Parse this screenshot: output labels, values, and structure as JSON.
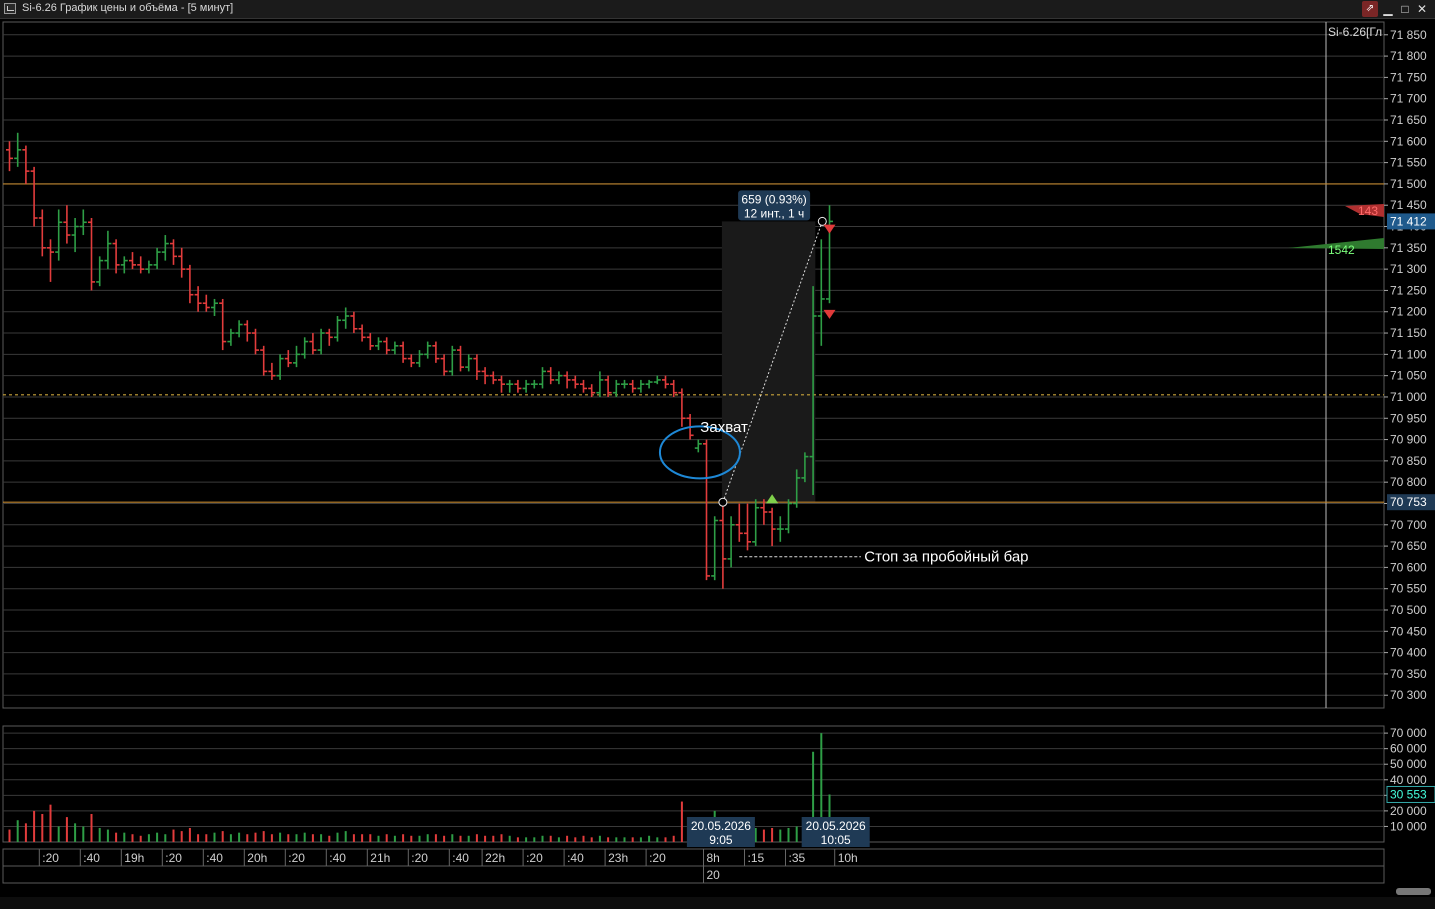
{
  "window": {
    "title": "Si-6.26 График цены и объёма - [5 минут]",
    "buttons": {
      "pin": "⇗",
      "minimize": "▁",
      "maximize": "□",
      "close": "✕"
    },
    "icons": {
      "app": "chart-window-icon",
      "pin": "pin-icon"
    }
  },
  "chart_data": {
    "type": "candlestick",
    "instrument_label": "Si-6.26[Гл",
    "price_axis": {
      "range": [
        70270,
        71880
      ],
      "ticks": [
        71850,
        71800,
        71750,
        71700,
        71650,
        71600,
        71550,
        71500,
        71450,
        71400,
        71350,
        71300,
        71250,
        71200,
        71150,
        71100,
        71050,
        71000,
        70950,
        70900,
        70850,
        70800,
        70750,
        70700,
        70650,
        70600,
        70550,
        70500,
        70450,
        70400,
        70350,
        70300
      ],
      "tick_labels": [
        "71 850",
        "71 800",
        "71 750",
        "71 700",
        "71 650",
        "71 600",
        "71 550",
        "71 500",
        "71 450",
        "71 400",
        "71 350",
        "71 300",
        "71 250",
        "71 200",
        "71 150",
        "71 100",
        "71 050",
        "71 000",
        "70 950",
        "70 900",
        "70 850",
        "70 800",
        "70 750",
        "70 700",
        "70 650",
        "70 600",
        "70 550",
        "70 500",
        "70 450",
        "70 400",
        "70 350",
        "70 300"
      ]
    },
    "current_price": {
      "value": 71412,
      "label": "71 412",
      "color": "#1f5a8c"
    },
    "reference_price": {
      "value": 70753,
      "label": "70 753"
    },
    "horizontal_lines": [
      {
        "price": 71500,
        "style": "solid",
        "color": "#c0862e"
      },
      {
        "price": 71005,
        "style": "dashed",
        "color": "#c9a43a"
      },
      {
        "price": 70753,
        "style": "solid",
        "color": "#c0862e"
      }
    ],
    "measure": {
      "label_line1": "659 (0.93%)",
      "label_line2": "12 инт., 1 ч",
      "from": {
        "bar": 87,
        "price": 70753
      },
      "to": {
        "bar": 99,
        "price": 71412
      }
    },
    "annotations": [
      {
        "text": "Захват",
        "bar": 84,
        "price": 70930
      },
      {
        "text": "Стоп за пробойный бар",
        "bar": 104,
        "price": 70625
      }
    ],
    "stop_line": {
      "from_bar": 89,
      "to_bar": 102,
      "price": 70625
    },
    "ellipse": {
      "bar": 84.2,
      "price": 70870
    },
    "signals": [
      {
        "type": "buy",
        "bar": 93,
        "price": 70760,
        "color": "#7fd04a"
      },
      {
        "type": "sell",
        "bar": 100,
        "price": 71395,
        "color": "#e03a3a"
      },
      {
        "type": "sell",
        "bar": 100,
        "price": 71195,
        "color": "#e03a3a"
      }
    ],
    "profile": {
      "sell_label": "143",
      "buy_label": "1542",
      "sell_color": "#b03030",
      "buy_color": "#2f7a2f"
    },
    "volume_axis": {
      "range": [
        0,
        72000
      ],
      "ticks": [
        70000,
        60000,
        50000,
        40000,
        30000,
        20000,
        10000
      ],
      "tick_labels": [
        "70 000",
        "60 000",
        "50 000",
        "40 000",
        "30 000",
        "20 000",
        "10 000"
      ],
      "current_label": "30 553",
      "current_value": 30553
    },
    "time_axis": {
      "labels": [
        {
          "text": ":20",
          "bar": 4
        },
        {
          "text": ":40",
          "bar": 9
        },
        {
          "text": "19h",
          "bar": 14
        },
        {
          "text": ":20",
          "bar": 19
        },
        {
          "text": ":40",
          "bar": 24
        },
        {
          "text": "20h",
          "bar": 29
        },
        {
          "text": ":20",
          "bar": 34
        },
        {
          "text": ":40",
          "bar": 39
        },
        {
          "text": "21h",
          "bar": 44
        },
        {
          "text": ":20",
          "bar": 49
        },
        {
          "text": ":40",
          "bar": 54
        },
        {
          "text": "22h",
          "bar": 58
        },
        {
          "text": ":20",
          "bar": 63
        },
        {
          "text": ":40",
          "bar": 68
        },
        {
          "text": "23h",
          "bar": 73
        },
        {
          "text": ":20",
          "bar": 78
        },
        {
          "text": "8h",
          "bar": 85
        },
        {
          "text": ":15",
          "bar": 90
        },
        {
          "text": ":35",
          "bar": 95
        },
        {
          "text": "10h",
          "bar": 101
        }
      ],
      "day_label": {
        "text": "20",
        "bar": 85
      },
      "cursor_labels": [
        {
          "bar": 87,
          "line1": "20.05.2026",
          "line2": "9:05"
        },
        {
          "bar": 101,
          "line1": "20.05.2026",
          "line2": "10:05"
        }
      ]
    },
    "colors": {
      "up": "#2e9e46",
      "down": "#e23c3c",
      "grid": "#3a3a3a",
      "axis_text": "#cfcfcf",
      "measure_box": "#1f3a55"
    },
    "bars": [
      {
        "o": 71580,
        "h": 71600,
        "l": 71530,
        "c": 71560,
        "v": 8000
      },
      {
        "o": 71560,
        "h": 71620,
        "l": 71540,
        "c": 71580,
        "v": 14000
      },
      {
        "o": 71580,
        "h": 71590,
        "l": 71500,
        "c": 71530,
        "v": 12000
      },
      {
        "o": 71530,
        "h": 71540,
        "l": 71400,
        "c": 71420,
        "v": 20000
      },
      {
        "o": 71420,
        "h": 71440,
        "l": 71330,
        "c": 71350,
        "v": 18000
      },
      {
        "o": 71350,
        "h": 71370,
        "l": 71270,
        "c": 71340,
        "v": 24000
      },
      {
        "o": 71340,
        "h": 71440,
        "l": 71320,
        "c": 71410,
        "v": 10000
      },
      {
        "o": 71410,
        "h": 71450,
        "l": 71360,
        "c": 71380,
        "v": 16000
      },
      {
        "o": 71380,
        "h": 71420,
        "l": 71340,
        "c": 71400,
        "v": 12000
      },
      {
        "o": 71400,
        "h": 71440,
        "l": 71380,
        "c": 71410,
        "v": 10000
      },
      {
        "o": 71410,
        "h": 71420,
        "l": 71250,
        "c": 71270,
        "v": 18000
      },
      {
        "o": 71270,
        "h": 71330,
        "l": 71260,
        "c": 71320,
        "v": 9000
      },
      {
        "o": 71320,
        "h": 71390,
        "l": 71300,
        "c": 71360,
        "v": 8000
      },
      {
        "o": 71360,
        "h": 71370,
        "l": 71290,
        "c": 71310,
        "v": 6000
      },
      {
        "o": 71310,
        "h": 71330,
        "l": 71290,
        "c": 71320,
        "v": 6000
      },
      {
        "o": 71320,
        "h": 71340,
        "l": 71300,
        "c": 71310,
        "v": 5000
      },
      {
        "o": 71310,
        "h": 71330,
        "l": 71290,
        "c": 71300,
        "v": 4000
      },
      {
        "o": 71300,
        "h": 71320,
        "l": 71290,
        "c": 71310,
        "v": 5000
      },
      {
        "o": 71310,
        "h": 71350,
        "l": 71300,
        "c": 71340,
        "v": 6000
      },
      {
        "o": 71340,
        "h": 71380,
        "l": 71320,
        "c": 71360,
        "v": 5000
      },
      {
        "o": 71360,
        "h": 71370,
        "l": 71310,
        "c": 71330,
        "v": 8000
      },
      {
        "o": 71330,
        "h": 71350,
        "l": 71280,
        "c": 71300,
        "v": 7000
      },
      {
        "o": 71300,
        "h": 71310,
        "l": 71220,
        "c": 71240,
        "v": 9000
      },
      {
        "o": 71240,
        "h": 71260,
        "l": 71200,
        "c": 71220,
        "v": 5000
      },
      {
        "o": 71220,
        "h": 71240,
        "l": 71200,
        "c": 71210,
        "v": 5000
      },
      {
        "o": 71210,
        "h": 71230,
        "l": 71190,
        "c": 71220,
        "v": 6000
      },
      {
        "o": 71220,
        "h": 71230,
        "l": 71110,
        "c": 71130,
        "v": 7000
      },
      {
        "o": 71130,
        "h": 71160,
        "l": 71120,
        "c": 71150,
        "v": 5000
      },
      {
        "o": 71150,
        "h": 71180,
        "l": 71140,
        "c": 71170,
        "v": 6000
      },
      {
        "o": 71170,
        "h": 71180,
        "l": 71130,
        "c": 71150,
        "v": 5000
      },
      {
        "o": 71150,
        "h": 71160,
        "l": 71100,
        "c": 71110,
        "v": 6000
      },
      {
        "o": 71110,
        "h": 71120,
        "l": 71050,
        "c": 71060,
        "v": 7000
      },
      {
        "o": 71060,
        "h": 71080,
        "l": 71040,
        "c": 71050,
        "v": 5000
      },
      {
        "o": 71050,
        "h": 71100,
        "l": 71040,
        "c": 71090,
        "v": 6000
      },
      {
        "o": 71090,
        "h": 71110,
        "l": 71070,
        "c": 71080,
        "v": 5000
      },
      {
        "o": 71080,
        "h": 71120,
        "l": 71070,
        "c": 71100,
        "v": 5000
      },
      {
        "o": 71100,
        "h": 71140,
        "l": 71090,
        "c": 71130,
        "v": 6000
      },
      {
        "o": 71130,
        "h": 71150,
        "l": 71100,
        "c": 71110,
        "v": 5000
      },
      {
        "o": 71110,
        "h": 71160,
        "l": 71100,
        "c": 71150,
        "v": 5000
      },
      {
        "o": 71150,
        "h": 71160,
        "l": 71120,
        "c": 71140,
        "v": 4000
      },
      {
        "o": 71140,
        "h": 71190,
        "l": 71130,
        "c": 71180,
        "v": 6000
      },
      {
        "o": 71180,
        "h": 71210,
        "l": 71160,
        "c": 71190,
        "v": 7000
      },
      {
        "o": 71190,
        "h": 71200,
        "l": 71150,
        "c": 71160,
        "v": 5000
      },
      {
        "o": 71160,
        "h": 71170,
        "l": 71130,
        "c": 71140,
        "v": 5000
      },
      {
        "o": 71140,
        "h": 71150,
        "l": 71110,
        "c": 71120,
        "v": 5000
      },
      {
        "o": 71120,
        "h": 71140,
        "l": 71110,
        "c": 71130,
        "v": 4000
      },
      {
        "o": 71130,
        "h": 71140,
        "l": 71100,
        "c": 71110,
        "v": 5000
      },
      {
        "o": 71110,
        "h": 71130,
        "l": 71100,
        "c": 71120,
        "v": 4000
      },
      {
        "o": 71120,
        "h": 71130,
        "l": 71080,
        "c": 71090,
        "v": 5000
      },
      {
        "o": 71090,
        "h": 71100,
        "l": 71070,
        "c": 71080,
        "v": 4000
      },
      {
        "o": 71080,
        "h": 71110,
        "l": 71070,
        "c": 71100,
        "v": 4000
      },
      {
        "o": 71100,
        "h": 71130,
        "l": 71090,
        "c": 71120,
        "v": 5000
      },
      {
        "o": 71120,
        "h": 71130,
        "l": 71080,
        "c": 71090,
        "v": 5000
      },
      {
        "o": 71090,
        "h": 71100,
        "l": 71050,
        "c": 71060,
        "v": 4000
      },
      {
        "o": 71060,
        "h": 71120,
        "l": 71050,
        "c": 71110,
        "v": 5000
      },
      {
        "o": 71110,
        "h": 71120,
        "l": 71060,
        "c": 71070,
        "v": 4000
      },
      {
        "o": 71070,
        "h": 71100,
        "l": 71060,
        "c": 71090,
        "v": 4000
      },
      {
        "o": 71090,
        "h": 71100,
        "l": 71040,
        "c": 71060,
        "v": 5000
      },
      {
        "o": 71060,
        "h": 71070,
        "l": 71030,
        "c": 71050,
        "v": 4000
      },
      {
        "o": 71050,
        "h": 71060,
        "l": 71030,
        "c": 71040,
        "v": 4000
      },
      {
        "o": 71040,
        "h": 71050,
        "l": 71010,
        "c": 71030,
        "v": 5000
      },
      {
        "o": 71030,
        "h": 71040,
        "l": 71010,
        "c": 71030,
        "v": 4000
      },
      {
        "o": 71030,
        "h": 71040,
        "l": 71010,
        "c": 71020,
        "v": 3000
      },
      {
        "o": 71020,
        "h": 71040,
        "l": 71010,
        "c": 71030,
        "v": 3000
      },
      {
        "o": 71030,
        "h": 71040,
        "l": 71020,
        "c": 71030,
        "v": 3000
      },
      {
        "o": 71030,
        "h": 71070,
        "l": 71020,
        "c": 71060,
        "v": 4000
      },
      {
        "o": 71060,
        "h": 71070,
        "l": 71030,
        "c": 71040,
        "v": 4000
      },
      {
        "o": 71040,
        "h": 71060,
        "l": 71030,
        "c": 71050,
        "v": 3000
      },
      {
        "o": 71050,
        "h": 71060,
        "l": 71020,
        "c": 71040,
        "v": 4000
      },
      {
        "o": 71040,
        "h": 71050,
        "l": 71020,
        "c": 71030,
        "v": 3000
      },
      {
        "o": 71030,
        "h": 71040,
        "l": 71010,
        "c": 71020,
        "v": 4000
      },
      {
        "o": 71020,
        "h": 71030,
        "l": 71000,
        "c": 71010,
        "v": 3000
      },
      {
        "o": 71010,
        "h": 71060,
        "l": 71000,
        "c": 71040,
        "v": 4000
      },
      {
        "o": 71040,
        "h": 71050,
        "l": 71000,
        "c": 71010,
        "v": 3000
      },
      {
        "o": 71010,
        "h": 71040,
        "l": 71000,
        "c": 71030,
        "v": 3000
      },
      {
        "o": 71030,
        "h": 71040,
        "l": 71020,
        "c": 71030,
        "v": 3000
      },
      {
        "o": 71030,
        "h": 71040,
        "l": 71010,
        "c": 71020,
        "v": 3000
      },
      {
        "o": 71020,
        "h": 71040,
        "l": 71010,
        "c": 71030,
        "v": 3000
      },
      {
        "o": 71030,
        "h": 71040,
        "l": 71020,
        "c": 71035,
        "v": 4000
      },
      {
        "o": 71035,
        "h": 71050,
        "l": 71030,
        "c": 71040,
        "v": 3000
      },
      {
        "o": 71040,
        "h": 71050,
        "l": 71020,
        "c": 71030,
        "v": 3000
      },
      {
        "o": 71030,
        "h": 71040,
        "l": 71000,
        "c": 71010,
        "v": 4000
      },
      {
        "o": 71010,
        "h": 71020,
        "l": 70930,
        "c": 70950,
        "v": 26000
      },
      {
        "o": 70950,
        "h": 70960,
        "l": 70900,
        "c": 70910,
        "v": 12000
      },
      {
        "o": 70880,
        "h": 70900,
        "l": 70870,
        "c": 70890,
        "v": 6000
      },
      {
        "o": 70890,
        "h": 70900,
        "l": 70570,
        "c": 70580,
        "v": 14000
      },
      {
        "o": 70580,
        "h": 70720,
        "l": 70570,
        "c": 70710,
        "v": 20000
      },
      {
        "o": 70710,
        "h": 70750,
        "l": 70550,
        "c": 70620,
        "v": 9000
      },
      {
        "o": 70620,
        "h": 70720,
        "l": 70600,
        "c": 70700,
        "v": 10000
      },
      {
        "o": 70700,
        "h": 70750,
        "l": 70660,
        "c": 70680,
        "v": 8000
      },
      {
        "o": 70680,
        "h": 70750,
        "l": 70640,
        "c": 70660,
        "v": 7000
      },
      {
        "o": 70660,
        "h": 70760,
        "l": 70650,
        "c": 70740,
        "v": 9000
      },
      {
        "o": 70740,
        "h": 70760,
        "l": 70700,
        "c": 70730,
        "v": 8000
      },
      {
        "o": 70730,
        "h": 70740,
        "l": 70650,
        "c": 70690,
        "v": 9000
      },
      {
        "o": 70690,
        "h": 70720,
        "l": 70660,
        "c": 70690,
        "v": 8000
      },
      {
        "o": 70690,
        "h": 70760,
        "l": 70680,
        "c": 70750,
        "v": 9000
      },
      {
        "o": 70750,
        "h": 70830,
        "l": 70740,
        "c": 70810,
        "v": 10000
      },
      {
        "o": 70810,
        "h": 70870,
        "l": 70800,
        "c": 70860,
        "v": 14000
      },
      {
        "o": 70860,
        "h": 71260,
        "l": 70770,
        "c": 71190,
        "v": 58000
      },
      {
        "o": 71190,
        "h": 71370,
        "l": 71120,
        "c": 71230,
        "v": 70000
      },
      {
        "o": 71230,
        "h": 71450,
        "l": 71220,
        "c": 71412,
        "v": 30553
      }
    ]
  }
}
